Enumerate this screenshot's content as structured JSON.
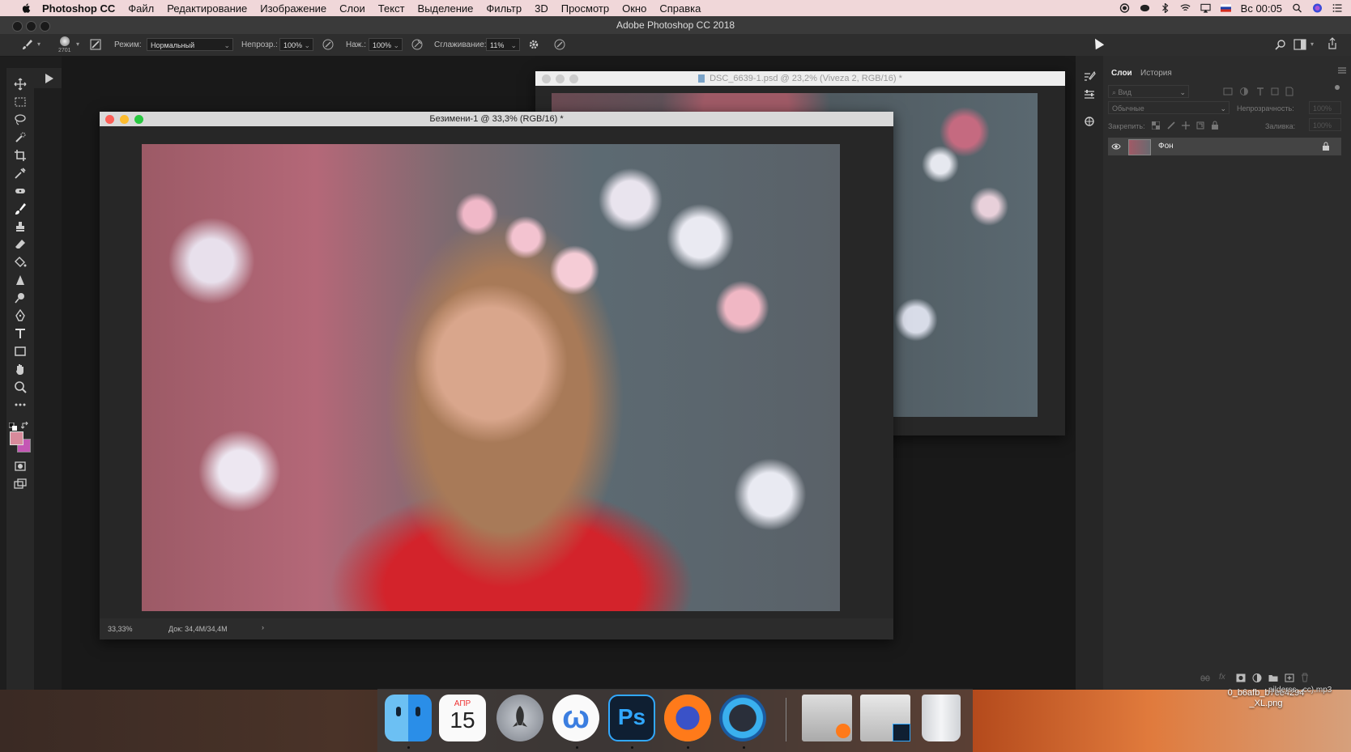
{
  "menubar": {
    "app_name": "Photoshop CC",
    "items": [
      "Файл",
      "Редактирование",
      "Изображение",
      "Слои",
      "Текст",
      "Выделение",
      "Фильтр",
      "3D",
      "Просмотр",
      "Окно",
      "Справка"
    ],
    "clock": "Вс 00:05"
  },
  "window": {
    "title": "Adobe Photoshop CC 2018"
  },
  "options_bar": {
    "brush_size": "2701",
    "mode_label": "Режим:",
    "mode_value": "Нормальный",
    "opacity_label": "Непрозр.:",
    "opacity_value": "100%",
    "pressure_label": "Наж.:",
    "pressure_value": "100%",
    "smoothing_label": "Сглаживание:",
    "smoothing_value": "11%"
  },
  "documents": {
    "back": {
      "title": "DSC_6639-1.psd @ 23,2% (Viveza 2, RGB/16) *"
    },
    "front": {
      "title": "Безимени-1 @ 33,3% (RGB/16) *",
      "zoom": "33,33%",
      "doc_info": "Док: 34,4M/34,4M"
    }
  },
  "layers_panel": {
    "tabs": [
      "Слои",
      "История"
    ],
    "kind_filter": "Вид",
    "blend_mode": "Обычные",
    "opacity_label": "Непрозрачность:",
    "opacity_value": "100%",
    "lock_label": "Закрепить:",
    "fill_label": "Заливка:",
    "fill_value": "100%",
    "layers": [
      {
        "name": "Фон",
        "visible": true,
        "locked": true
      }
    ]
  },
  "dock": {
    "calendar_month": "АПР",
    "calendar_day": "15",
    "apps": [
      "finder",
      "calendar",
      "launchpad",
      "wunderlist",
      "photoshop",
      "firefox",
      "quicktime",
      "document-preview",
      "photoshop-file",
      "trash"
    ]
  },
  "desktop": {
    "file_label_line1": "0_b6afb_b7ee4294",
    "file_label_line2": "_XL.png",
    "file_label_overlap": "pilderss...cc).mp3"
  },
  "colors": {
    "foreground": "#d78a9b",
    "background": "#c457b4",
    "menubar_bg": "#f0d7d9"
  }
}
